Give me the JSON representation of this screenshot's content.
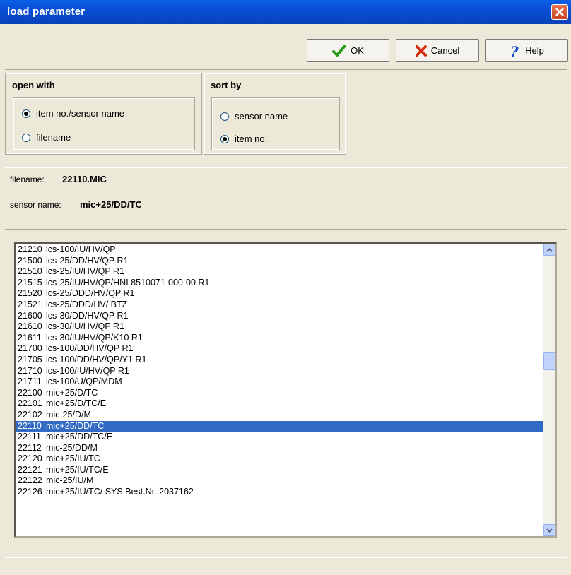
{
  "window": {
    "title": "load parameter"
  },
  "toolbar": {
    "ok_label": "OK",
    "cancel_label": "Cancel",
    "help_label": "Help"
  },
  "open_with": {
    "title": "open with",
    "options": [
      {
        "label": "item no./sensor name",
        "selected": true
      },
      {
        "label": "filename",
        "selected": false
      }
    ]
  },
  "sort_by": {
    "title": "sort by",
    "options": [
      {
        "label": "sensor name",
        "selected": false
      },
      {
        "label": "item no.",
        "selected": true
      }
    ]
  },
  "info": {
    "filename_label": "filename:",
    "filename_value": "22110.MIC",
    "sensor_label": "sensor name:",
    "sensor_value": "mic+25/DD/TC"
  },
  "list": {
    "selected_index": 16,
    "items": [
      {
        "no": "21210",
        "name": "lcs-100/IU/HV/QP"
      },
      {
        "no": "21500",
        "name": "lcs-25/DD/HV/QP R1"
      },
      {
        "no": "21510",
        "name": "lcs-25/IU/HV/QP R1"
      },
      {
        "no": "21515",
        "name": "lcs-25/IU/HV/QP/HNI 8510071-000-00 R1"
      },
      {
        "no": "21520",
        "name": "lcs-25/DDD/HV/QP R1"
      },
      {
        "no": "21521",
        "name": "lcs-25/DDD/HV/ BTZ"
      },
      {
        "no": "21600",
        "name": "lcs-30/DD/HV/QP R1"
      },
      {
        "no": "21610",
        "name": "lcs-30/IU/HV/QP R1"
      },
      {
        "no": "21611",
        "name": "lcs-30/IU/HV/QP/K10 R1"
      },
      {
        "no": "21700",
        "name": "lcs-100/DD/HV/QP R1"
      },
      {
        "no": "21705",
        "name": "lcs-100/DD/HV/QP/Y1 R1"
      },
      {
        "no": "21710",
        "name": "lcs-100/IU/HV/QP R1"
      },
      {
        "no": "21711",
        "name": "lcs-100/U/QP/MDM"
      },
      {
        "no": "22100",
        "name": "mic+25/D/TC"
      },
      {
        "no": "22101",
        "name": "mic+25/D/TC/E"
      },
      {
        "no": "22102",
        "name": "mic-25/D/M"
      },
      {
        "no": "22110",
        "name": "mic+25/DD/TC"
      },
      {
        "no": "22111",
        "name": "mic+25/DD/TC/E"
      },
      {
        "no": "22112",
        "name": "mic-25/DD/M"
      },
      {
        "no": "22120",
        "name": "mic+25/IU/TC"
      },
      {
        "no": "22121",
        "name": "mic+25/IU/TC/E"
      },
      {
        "no": "22122",
        "name": "mic-25/IU/M"
      },
      {
        "no": "22126",
        "name": "mic+25/IU/TC/ SYS Best.Nr.:2037162"
      }
    ]
  },
  "colors": {
    "titlebar": "#0a4fd4",
    "selection": "#316ac5",
    "face": "#ece9d8"
  }
}
